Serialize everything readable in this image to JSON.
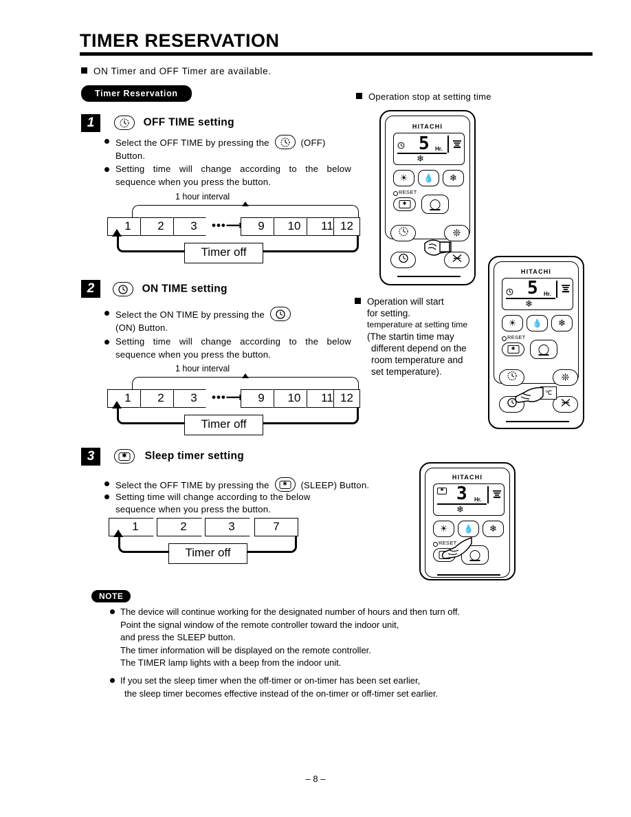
{
  "header": {
    "title": "TIMER RESERVATION",
    "intro": "ON Timer and OFF Timer are available.",
    "badge": "Timer Reservation"
  },
  "steps": [
    {
      "number": "1",
      "icon": "clock-off-icon",
      "heading": "OFF TIME setting",
      "bullet1_a": "Select the OFF TIME by pressing the",
      "bullet1_b": "(OFF)",
      "bullet1_c": "Button.",
      "bullet2_line1": "Setting time will change according to the below",
      "bullet2_line2": "sequence when you press the button."
    },
    {
      "number": "2",
      "icon": "clock-on-icon",
      "heading": "ON TIME setting",
      "bullet1_a": "Select the ON TIME by pressing the",
      "bullet1_c": "(ON) Button.",
      "bullet2_line1": "Setting time will change according to the below",
      "bullet2_line2": "sequence when you press the button."
    },
    {
      "number": "3",
      "icon": "sleep-icon",
      "heading": "Sleep timer setting",
      "bullet1_a": "Select the OFF TIME by pressing the",
      "bullet1_c": "(SLEEP) Button.",
      "bullet2_line1": "Setting time will change according to the below",
      "bullet2_line2": "sequence when you press the button."
    }
  ],
  "sequences": {
    "hour_label": "1 hour interval",
    "timer_off": "Timer off",
    "ellipsis_arrow": "•••",
    "off_steps": [
      "1",
      "2",
      "3",
      "9",
      "10",
      "11",
      "12"
    ],
    "on_steps": [
      "1",
      "2",
      "3",
      "9",
      "10",
      "11",
      "12"
    ],
    "sleep_steps": [
      "1",
      "2",
      "3",
      "7"
    ]
  },
  "captions": {
    "stop": "Operation stop at setting time",
    "start_line1": "Operation  will  start",
    "start_line2": "for  setting.",
    "start_line3": "temperature at setting time",
    "start_line4": "(The startin time  may",
    "start_line5": "different depend on the",
    "start_line6": "room temperature  and",
    "start_line7": "set temperature)."
  },
  "remote": {
    "brand": "HITACHI",
    "reset_label": "RESET",
    "hr_label": "Hr.",
    "display_off": "5",
    "display_on": "5",
    "display_sleep": "3",
    "temp_unit": "℃"
  },
  "note": {
    "badge": "NOTE",
    "b1_l1": "The device will continue working for the designated number of hours and then turn off.",
    "b1_l2": "Point the signal window of the remote controller toward the indoor unit,",
    "b1_l3": "and press the SLEEP button.",
    "b1_l4": "The timer information will be displayed on the remote controller.",
    "b1_l5": "The TIMER lamp lights with a beep from the indoor unit.",
    "b2_l1": "If you set the sleep timer when the off-timer or on-timer has been set earlier,",
    "b2_l2": "the sleep timer becomes effective instead of the on-timer or off-timer set earlier."
  },
  "footer": {
    "page": "–  8  –"
  }
}
